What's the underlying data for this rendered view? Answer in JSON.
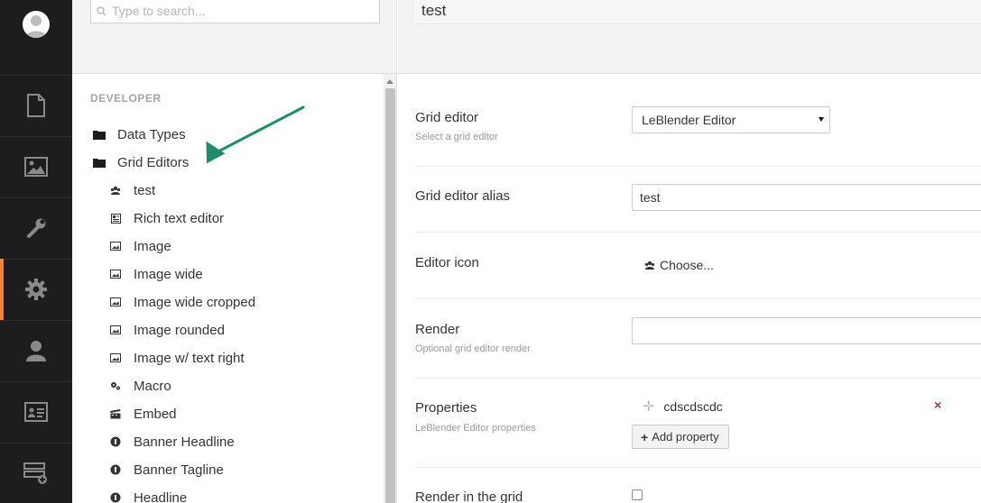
{
  "search": {
    "placeholder": "Type to search..."
  },
  "section": {
    "title": "DEVELOPER"
  },
  "tree": {
    "data_types": "Data Types",
    "grid_editors": "Grid Editors",
    "children": [
      {
        "label": "test",
        "icon": "users-icon"
      },
      {
        "label": "Rich text editor",
        "icon": "article-icon"
      },
      {
        "label": "Image",
        "icon": "picture-icon"
      },
      {
        "label": "Image wide",
        "icon": "picture-icon"
      },
      {
        "label": "Image wide cropped",
        "icon": "picture-icon"
      },
      {
        "label": "Image rounded",
        "icon": "picture-icon"
      },
      {
        "label": "Image w/ text right",
        "icon": "picture-icon"
      },
      {
        "label": "Macro",
        "icon": "settings-icon"
      },
      {
        "label": "Embed",
        "icon": "movie-icon"
      },
      {
        "label": "Banner Headline",
        "icon": "circle-info-icon"
      },
      {
        "label": "Banner Tagline",
        "icon": "circle-info-icon"
      },
      {
        "label": "Headline",
        "icon": "circle-info-icon"
      }
    ]
  },
  "editor": {
    "name": "test",
    "grid_editor": {
      "label": "Grid editor",
      "desc": "Select a grid editor",
      "value": "LeBlender Editor"
    },
    "alias": {
      "label": "Grid editor alias",
      "value": "test"
    },
    "icon": {
      "label": "Editor icon",
      "choose": "Choose..."
    },
    "render": {
      "label": "Render",
      "desc": "Optional grid editor render",
      "value": ""
    },
    "properties": {
      "label": "Properties",
      "desc": "LeBlender Editor properties",
      "item": "cdscdscdc",
      "remove": "×",
      "add_plus": "+",
      "add": "Add property"
    },
    "render_in_grid": {
      "label": "Render in the grid"
    }
  },
  "colors": {
    "rail_bg": "#1d1d1d",
    "active_accent": "#f5823a",
    "arrow": "#1e8c6a",
    "remove": "#aa3333"
  }
}
